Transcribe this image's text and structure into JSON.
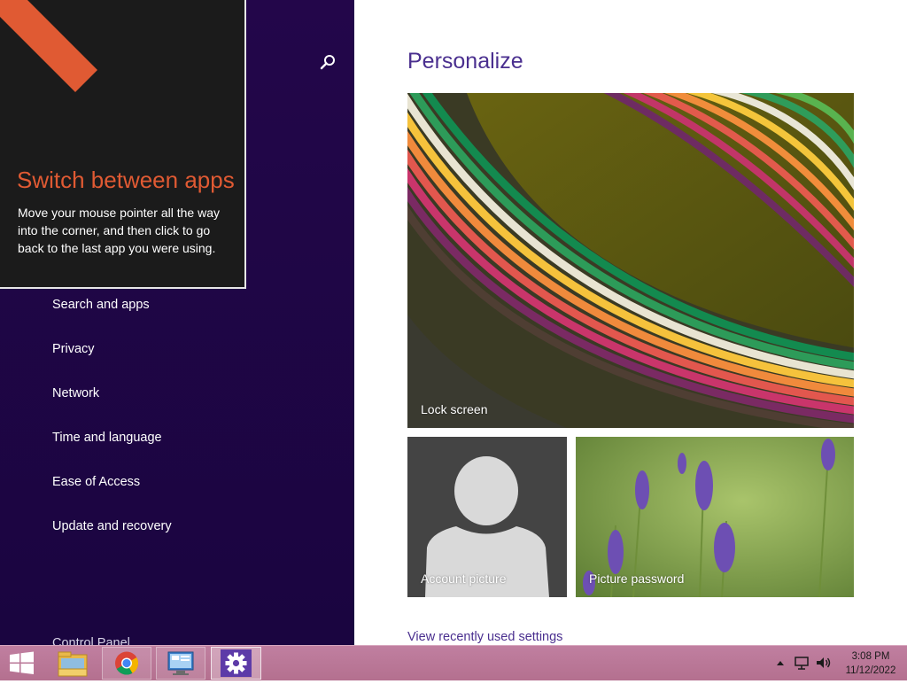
{
  "tip": {
    "title": "Switch between apps",
    "body": "Move your mouse pointer all the way into the corner, and then click to go back to the last app you were using."
  },
  "sidebar": {
    "items": [
      {
        "label": "Search and apps"
      },
      {
        "label": "Privacy"
      },
      {
        "label": "Network"
      },
      {
        "label": "Time and language"
      },
      {
        "label": "Ease of Access"
      },
      {
        "label": "Update and recovery"
      }
    ],
    "control_panel_label": "Control Panel"
  },
  "main": {
    "title": "Personalize",
    "tiles": {
      "lock_screen": "Lock screen",
      "account_picture": "Account picture",
      "picture_password": "Picture password"
    },
    "recent_link": "View recently used settings"
  },
  "taskbar": {
    "time": "3:08 PM",
    "date": "11/12/2022"
  },
  "colors": {
    "sidebar_bg": "#23064a",
    "accent_tip": "#e05a33",
    "heading": "#4a2f8f",
    "taskbar": "#b4708f"
  },
  "icons": [
    "search-icon",
    "windows-logo-icon",
    "file-explorer-icon",
    "chrome-icon",
    "remote-desktop-icon",
    "settings-gear-icon",
    "chevron-up-icon",
    "network-icon",
    "speaker-icon"
  ]
}
